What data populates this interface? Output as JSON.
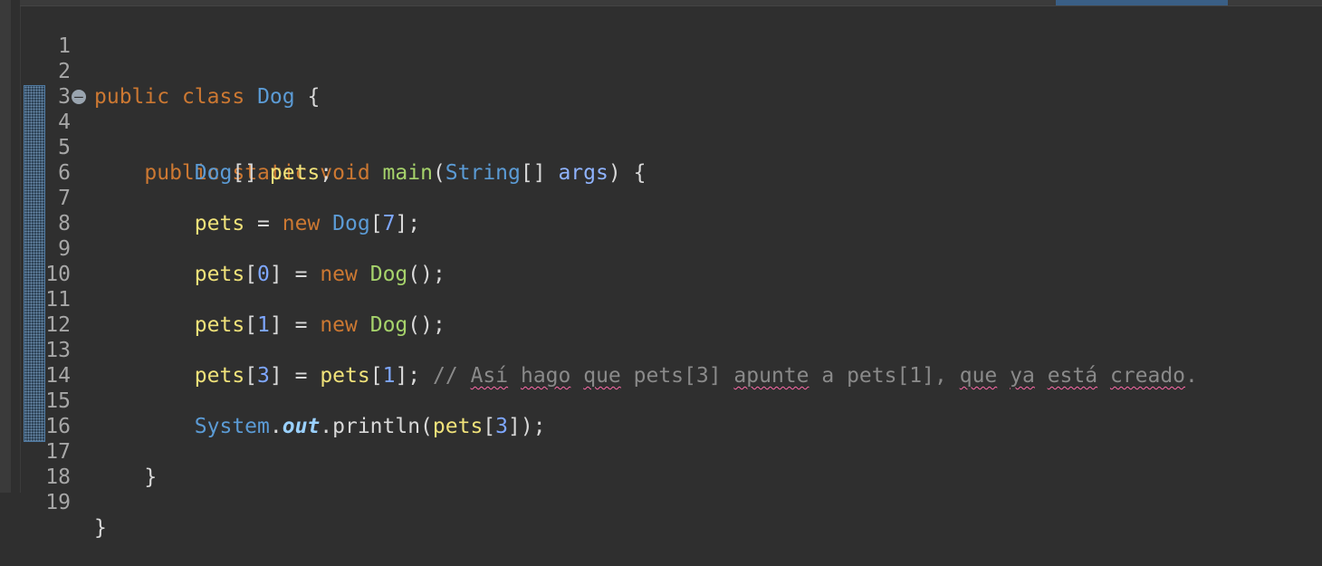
{
  "editor": {
    "lines": [
      {
        "number": "1"
      },
      {
        "number": "2",
        "t": [
          "public",
          "class",
          "Dog",
          "{"
        ]
      },
      {
        "number": "3"
      },
      {
        "number": "4",
        "t": [
          "public",
          "static",
          "void",
          "main",
          "(",
          "String",
          "[]",
          "args",
          ")",
          "{"
        ]
      },
      {
        "number": "5",
        "t": [
          "Dog",
          "[]",
          "pets",
          ";"
        ]
      },
      {
        "number": "6"
      },
      {
        "number": "7",
        "t": [
          "pets",
          "=",
          "new",
          "Dog",
          "[",
          "7",
          "];"
        ]
      },
      {
        "number": "8"
      },
      {
        "number": "9",
        "t": [
          "pets",
          "[",
          "0",
          "]",
          "=",
          "new",
          "Dog",
          "();"
        ]
      },
      {
        "number": "10"
      },
      {
        "number": "11",
        "t": [
          "pets",
          "[",
          "1",
          "]",
          "=",
          "new",
          "Dog",
          "();"
        ]
      },
      {
        "number": "12"
      },
      {
        "number": "13",
        "t": [
          "pets",
          "[",
          "3",
          "]",
          "=",
          "pets",
          "[",
          "1",
          "];",
          "//",
          "Así",
          "hago",
          "que",
          "pets[3]",
          "apunte",
          "a pets[1],",
          "que",
          "ya",
          "está",
          "creado",
          "."
        ]
      },
      {
        "number": "14"
      },
      {
        "number": "15",
        "t": [
          "System",
          ".",
          "out",
          ".println(",
          "pets",
          "[",
          "3",
          "]);"
        ]
      },
      {
        "number": "16"
      },
      {
        "number": "17",
        "t": [
          "}"
        ]
      },
      {
        "number": "18"
      },
      {
        "number": "19",
        "t": [
          "}"
        ]
      }
    ]
  }
}
